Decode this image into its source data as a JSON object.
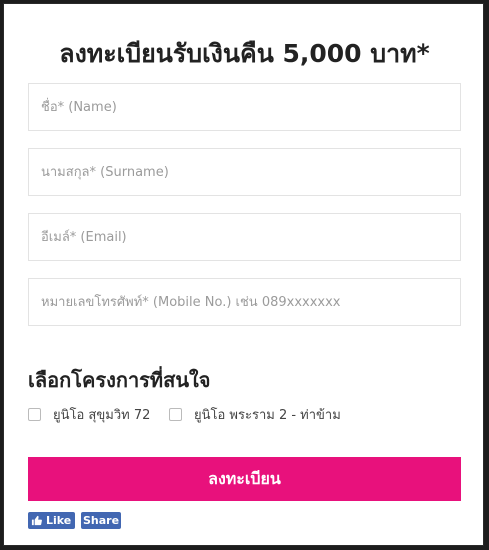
{
  "form": {
    "title": "ลงทะเบียนรับเงินคืน 5,000 บาท*",
    "fields": [
      {
        "placeholder": "ชื่อ* (Name)"
      },
      {
        "placeholder": "นามสกุล* (Surname)"
      },
      {
        "placeholder": "อีเมล์* (Email)"
      },
      {
        "placeholder": "หมายเลขโทรศัพท์* (Mobile No.) เช่น 089xxxxxxx"
      }
    ],
    "project_section_title": "เลือกโครงการที่สนใจ",
    "projects": [
      {
        "label": "ยูนิโอ สุขุมวิท 72"
      },
      {
        "label": "ยูนิโอ พระราม 2 - ท่าข้าม"
      }
    ],
    "submit_label": "ลงทะเบียน"
  },
  "social": {
    "like_label": "Like",
    "share_label": "Share",
    "color": "#4267b2"
  },
  "colors": {
    "accent": "#e8117c"
  }
}
